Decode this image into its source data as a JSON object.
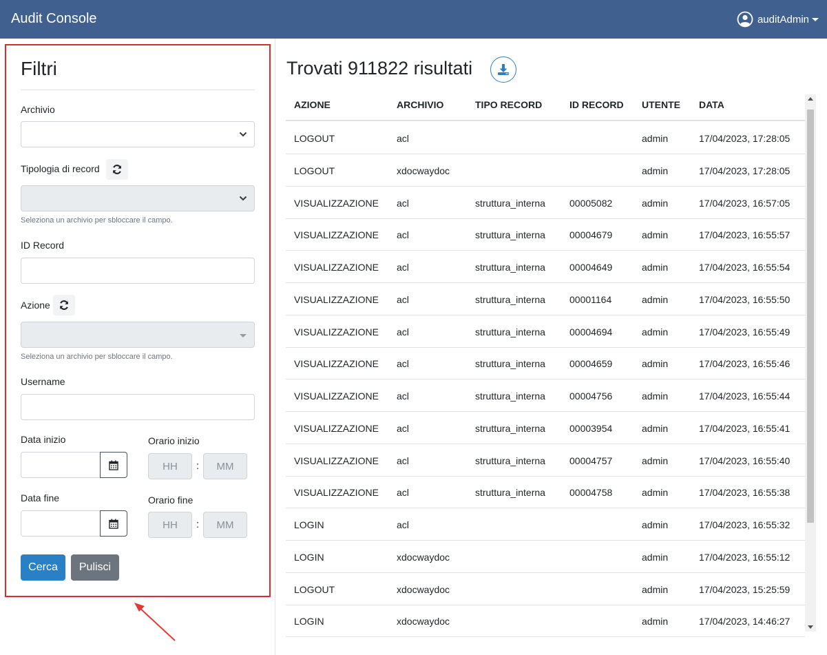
{
  "app": {
    "title": "Audit Console",
    "user": "auditAdmin"
  },
  "filters": {
    "title": "Filtri",
    "archivio_label": "Archivio",
    "archivio_value": "",
    "tipologia_label": "Tipologia di record",
    "tipologia_help": "Seleziona un archivio per sbloccare il campo.",
    "id_record_label": "ID Record",
    "azione_label": "Azione",
    "azione_help": "Seleziona un archivio per sbloccare il campo.",
    "username_label": "Username",
    "data_inizio_label": "Data inizio",
    "orario_inizio_label": "Orario inizio",
    "data_fine_label": "Data fine",
    "orario_fine_label": "Orario fine",
    "hh_placeholder": "HH",
    "mm_placeholder": "MM",
    "colon": ":",
    "search_button": "Cerca",
    "clear_button": "Pulisci"
  },
  "results": {
    "title": "Trovati 911822 risultati",
    "columns": [
      "AZIONE",
      "ARCHIVIO",
      "TIPO RECORD",
      "ID RECORD",
      "UTENTE",
      "DATA"
    ],
    "rows": [
      [
        "LOGOUT",
        "acl",
        "",
        "",
        "admin",
        "17/04/2023, 17:28:05"
      ],
      [
        "LOGOUT",
        "xdocwaydoc",
        "",
        "",
        "admin",
        "17/04/2023, 17:28:05"
      ],
      [
        "VISUALIZZAZIONE",
        "acl",
        "struttura_interna",
        "00005082",
        "admin",
        "17/04/2023, 16:57:05"
      ],
      [
        "VISUALIZZAZIONE",
        "acl",
        "struttura_interna",
        "00004679",
        "admin",
        "17/04/2023, 16:55:57"
      ],
      [
        "VISUALIZZAZIONE",
        "acl",
        "struttura_interna",
        "00004649",
        "admin",
        "17/04/2023, 16:55:54"
      ],
      [
        "VISUALIZZAZIONE",
        "acl",
        "struttura_interna",
        "00001164",
        "admin",
        "17/04/2023, 16:55:50"
      ],
      [
        "VISUALIZZAZIONE",
        "acl",
        "struttura_interna",
        "00004694",
        "admin",
        "17/04/2023, 16:55:49"
      ],
      [
        "VISUALIZZAZIONE",
        "acl",
        "struttura_interna",
        "00004659",
        "admin",
        "17/04/2023, 16:55:46"
      ],
      [
        "VISUALIZZAZIONE",
        "acl",
        "struttura_interna",
        "00004756",
        "admin",
        "17/04/2023, 16:55:44"
      ],
      [
        "VISUALIZZAZIONE",
        "acl",
        "struttura_interna",
        "00003954",
        "admin",
        "17/04/2023, 16:55:41"
      ],
      [
        "VISUALIZZAZIONE",
        "acl",
        "struttura_interna",
        "00004757",
        "admin",
        "17/04/2023, 16:55:40"
      ],
      [
        "VISUALIZZAZIONE",
        "acl",
        "struttura_interna",
        "00004758",
        "admin",
        "17/04/2023, 16:55:38"
      ],
      [
        "LOGIN",
        "acl",
        "",
        "",
        "admin",
        "17/04/2023, 16:55:32"
      ],
      [
        "LOGIN",
        "xdocwaydoc",
        "",
        "",
        "admin",
        "17/04/2023, 16:55:12"
      ],
      [
        "LOGOUT",
        "xdocwaydoc",
        "",
        "",
        "admin",
        "17/04/2023, 15:25:59"
      ],
      [
        "LOGIN",
        "xdocwaydoc",
        "",
        "",
        "admin",
        "17/04/2023, 14:46:27"
      ]
    ]
  },
  "icons": {
    "user": "user-circle-icon",
    "refresh": "refresh-icon",
    "calendar": "calendar-icon",
    "download": "download-icon",
    "annotation": "red-arrow-annotation"
  },
  "colors": {
    "navbar": "#40618f",
    "primary": "#2a80c4",
    "secondary": "#6c757d",
    "annotation": "#d32f2f"
  }
}
